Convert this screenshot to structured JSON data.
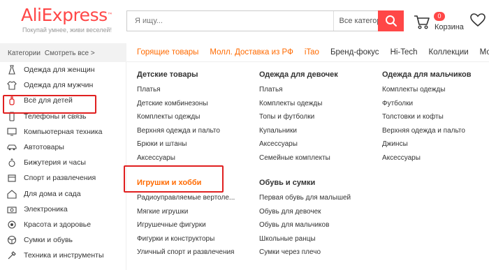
{
  "header": {
    "logo": "AliExpress",
    "tagline": "Покупай умнее, живи веселей!",
    "search_placeholder": "Я ищу...",
    "category_select": "Все категории",
    "cart_count": "0",
    "cart_label": "Корзина"
  },
  "catbar": {
    "title": "Категории",
    "see_all": "Смотреть все >"
  },
  "nav": {
    "items": [
      {
        "label": "Горящие товары",
        "hot": true
      },
      {
        "label": "Молл. Доставка из РФ",
        "hot": true
      },
      {
        "label": "iTao",
        "hot": true
      },
      {
        "label": "Бренд-фокус",
        "hot": false
      },
      {
        "label": "Hi-Tech",
        "hot": false
      },
      {
        "label": "Коллекции",
        "hot": false
      },
      {
        "label": "Мода",
        "hot": false
      }
    ]
  },
  "sidebar": {
    "items": [
      {
        "label": "Одежда для женщин",
        "icon": "dress-icon"
      },
      {
        "label": "Одежда для мужчин",
        "icon": "shirt-icon"
      },
      {
        "label": "Всё для детей",
        "icon": "baby-bottle-icon"
      },
      {
        "label": "Телефоны и связь",
        "icon": "phone-icon"
      },
      {
        "label": "Компьютерная техника",
        "icon": "computer-icon"
      },
      {
        "label": "Автотовары",
        "icon": "car-icon"
      },
      {
        "label": "Бижутерия и часы",
        "icon": "ring-icon"
      },
      {
        "label": "Спорт и развлечения",
        "icon": "sport-icon"
      },
      {
        "label": "Для дома и сада",
        "icon": "home-icon"
      },
      {
        "label": "Электроника",
        "icon": "camera-icon"
      },
      {
        "label": "Красота и здоровье",
        "icon": "beauty-icon"
      },
      {
        "label": "Сумки и обувь",
        "icon": "ball-icon"
      },
      {
        "label": "Техника и инструменты",
        "icon": "tools-icon"
      }
    ]
  },
  "menu": {
    "col1": {
      "head": "Детские товары",
      "items": [
        "Платья",
        "Детские комбинезоны",
        "Комплекты одежды",
        "Верхняя одежда и пальто",
        "Брюки и штаны",
        "Аксессуары"
      ],
      "head2": "Игрушки и хобби",
      "items2": [
        "Радиоуправляемые вертоле...",
        "Мягкие игрушки",
        "Игрушечные фигурки",
        "Фигурки и конструкторы",
        "Уличный спорт и развлечения"
      ]
    },
    "col2": {
      "head": "Одежда для девочек",
      "items": [
        "Платья",
        "Комплекты одежды",
        "Топы и футболки",
        "Купальники",
        "Аксессуары",
        "Семейные комплекты"
      ],
      "head2": "Обувь и сумки",
      "items2": [
        "Первая обувь для малышей",
        "Обувь для девочек",
        "Обувь для мальчиков",
        "Школьные ранцы",
        "Сумки через плечо"
      ]
    },
    "col3": {
      "head": "Одежда для мальчиков",
      "items": [
        "Комплекты одежды",
        "Футболки",
        "Толстовки и кофты",
        "Верхняя одежда и пальто",
        "Джинсы",
        "Аксессуары"
      ]
    }
  },
  "colors": {
    "accent": "#ff4747",
    "hot": "#ff6a00",
    "highlight": "#e02020"
  }
}
